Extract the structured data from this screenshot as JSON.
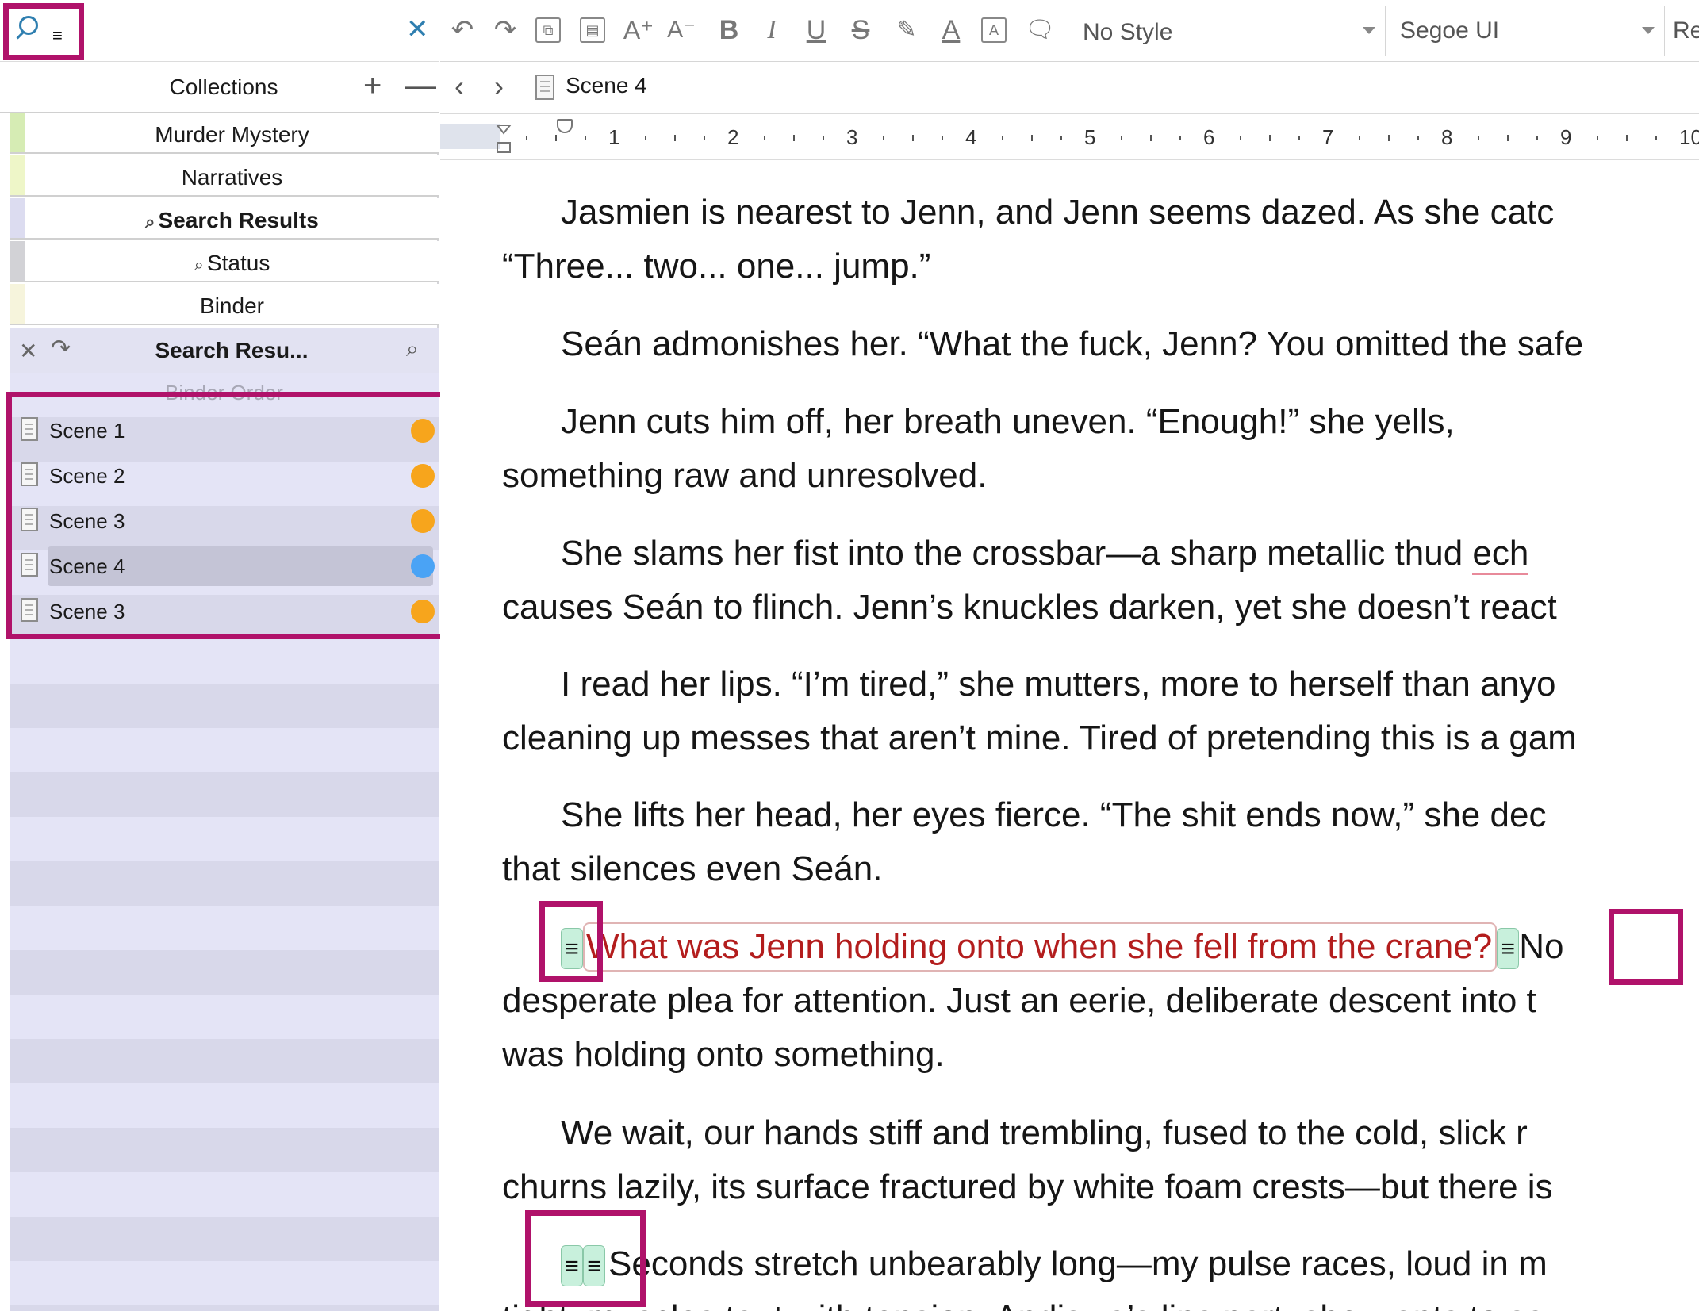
{
  "search": {
    "value": "",
    "placeholder": ""
  },
  "collections": {
    "title": "Collections",
    "add": "+",
    "remove": "—",
    "tabs": [
      {
        "label": "Murder Mystery",
        "color": "#d6ecb4",
        "bold": false,
        "search": false
      },
      {
        "label": "Narratives",
        "color": "#eef6c8",
        "bold": false,
        "search": false
      },
      {
        "label": "Search Results",
        "color": "#dcdcf0",
        "bold": true,
        "search": true
      },
      {
        "label": "Status",
        "color": "#d2d2d6",
        "bold": false,
        "search": true
      },
      {
        "label": "Binder",
        "color": "#f6f4dc",
        "bold": false,
        "search": false
      }
    ]
  },
  "results": {
    "title": "Search Resu...",
    "sort_label": "Binder Order",
    "items": [
      {
        "name": "Scene 1",
        "status_color": "#f7a51c",
        "selected": false
      },
      {
        "name": "Scene 2",
        "status_color": "#f7a51c",
        "selected": false
      },
      {
        "name": "Scene 3",
        "status_color": "#f7a51c",
        "selected": false
      },
      {
        "name": "Scene 4",
        "status_color": "#4aa3f5",
        "selected": true
      },
      {
        "name": "Scene 3",
        "status_color": "#f7a51c",
        "selected": false
      }
    ]
  },
  "toolbar": {
    "style": "No Style",
    "font": "Segoe UI",
    "weight": "Regul"
  },
  "nav": {
    "title": "Scene 4"
  },
  "ruler": {
    "numbers": [
      "1",
      "2",
      "3",
      "4",
      "5",
      "6",
      "7",
      "8",
      "9",
      "10"
    ]
  },
  "editor": {
    "p1": [
      "Jasmien is nearest to Jenn, and Jenn seems dazed. As she catc",
      "“Three... two... one... jump.”"
    ],
    "p2": [
      "Seán admonishes her. “What the fuck, Jenn? You omitted the safe"
    ],
    "p3": [
      "Jenn  cuts  him  off,  her  breath  uneven.  “Enough!”  she  yells,",
      "something raw and unresolved."
    ],
    "p4a": "She slams her fist into the crossbar—a sharp metallic thud ",
    "p4b": "ech",
    "p4c": "causes Seán to flinch. Jenn’s knuckles darken, yet she doesn’t react",
    "p5": [
      "I read her lips. “I’m tired,” she mutters, more to herself than anyo",
      "cleaning up messes that aren’t mine. Tired of pretending this is a gam"
    ],
    "p6": [
      "She lifts her head, her eyes fierce. “The shit ends now,” she dec",
      "that silences even Seán."
    ],
    "p7_comment": "What was Jenn holding onto when she fell from the crane?",
    "p7_tail": "No",
    "p7": [
      "desperate plea for attention. Just an eerie, deliberate descent into t",
      "was holding onto something."
    ],
    "p8": [
      "We wait, our hands stiff and trembling, fused to the cold, slick r",
      "churns lazily, its surface fractured by white foam crests—but there is"
    ],
    "p9": "Seconds stretch unbearably long—my pulse races, loud in m",
    "p10": "tight, muscles taut with tension. Andiswa’s lips part; she wants to sa",
    "chip": "≡"
  }
}
